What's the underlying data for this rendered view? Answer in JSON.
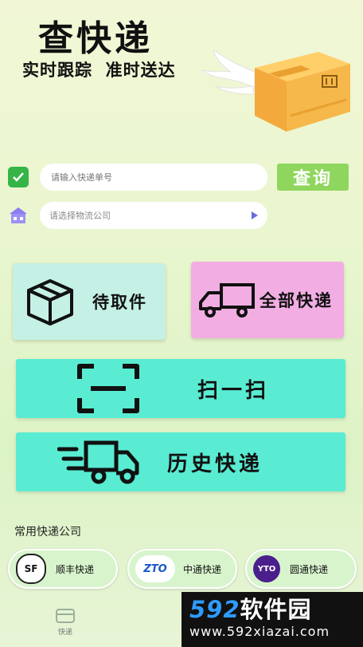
{
  "hero": {
    "title": "查快递",
    "subtitle": "实时跟踪  准时送达",
    "art_icon": "winged-parcel-icon"
  },
  "tracking_input": {
    "placeholder": "请输入快递单号",
    "value": ""
  },
  "company_select": {
    "placeholder": "请选择物流公司"
  },
  "query_button": {
    "label": "查询"
  },
  "quick_actions": {
    "pending_label": "待取件",
    "all_label": "全部快递",
    "scan_label": "扫一扫",
    "history_label": "历史快递"
  },
  "common_companies": {
    "title": "常用快递公司",
    "items": [
      {
        "name": "顺丰快递",
        "logo": "SF"
      },
      {
        "name": "中通快递",
        "logo": "ZTO"
      },
      {
        "name": "圆通快递",
        "logo": "YTO"
      }
    ]
  },
  "tabbar": {
    "home_label": "快递"
  },
  "watermark": {
    "brand_num": "592",
    "brand_text": "软件园",
    "url": "www.592xiazai.com"
  },
  "colors": {
    "check": "#36b448",
    "query_button": "#8fd65e",
    "pending_card": "#c5f0e5",
    "all_card": "#f2aee3",
    "wide_cards": "#59ecd2"
  }
}
